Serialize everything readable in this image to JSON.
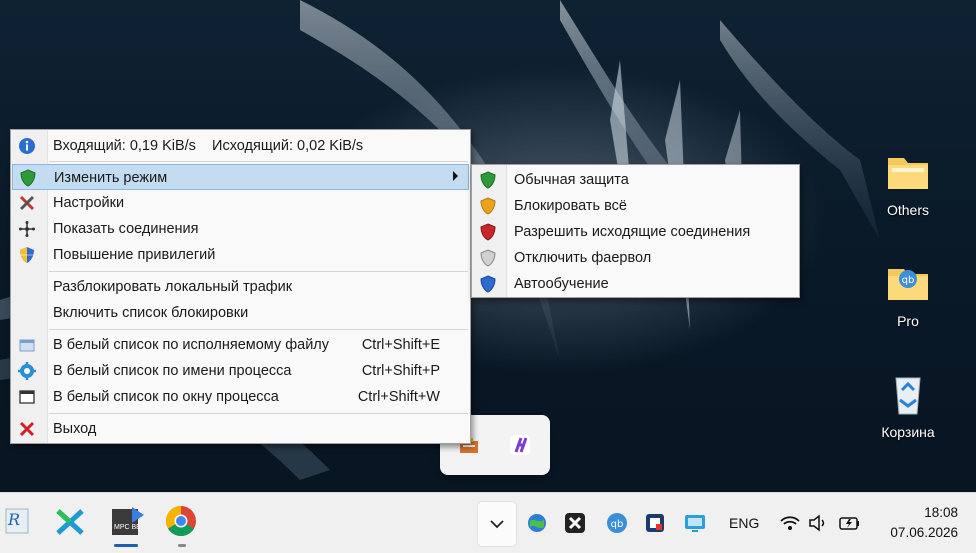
{
  "desktop": {
    "icons": [
      {
        "label": "Others",
        "icon": "folder-icon"
      },
      {
        "label": "Pro",
        "icon": "qbittorrent-folder-icon"
      },
      {
        "label": "Корзина",
        "icon": "recycle-bin-icon"
      }
    ]
  },
  "context_menu": {
    "traffic": {
      "label": "Входящий: 0,19 KiB/s    Исходящий: 0,02 KiB/s",
      "icon": "info-icon"
    },
    "items_group1": [
      {
        "label": "Изменить режим",
        "icon": "shield-green-icon",
        "highlighted": true,
        "has_submenu": true
      },
      {
        "label": "Настройки",
        "icon": "tools-icon"
      },
      {
        "label": "Показать соединения",
        "icon": "network-icon"
      },
      {
        "label": "Повышение привилегий",
        "icon": "uac-shield-icon"
      }
    ],
    "items_group2": [
      {
        "label": "Разблокировать локальный трафик"
      },
      {
        "label": "Включить список блокировки"
      }
    ],
    "items_group3": [
      {
        "label": "В белый список по исполняемому файлу",
        "shortcut": "Ctrl+Shift+E",
        "icon": "exe-file-icon"
      },
      {
        "label": "В белый список по имени процесса",
        "shortcut": "Ctrl+Shift+P",
        "icon": "process-gear-icon"
      },
      {
        "label": "В белый список по окну процесса",
        "shortcut": "Ctrl+Shift+W",
        "icon": "window-icon"
      }
    ],
    "exit": {
      "label": "Выход",
      "icon": "red-x-icon"
    }
  },
  "submenu": {
    "items": [
      {
        "label": "Обычная защита",
        "icon": "shield-green-icon",
        "color": "#2e9b3a"
      },
      {
        "label": "Блокировать всё",
        "icon": "shield-orange-icon",
        "color": "#e8a21c"
      },
      {
        "label": "Разрешить исходящие соединения",
        "icon": "shield-red-icon",
        "color": "#c9262b"
      },
      {
        "label": "Отключить фаервол",
        "icon": "shield-gray-icon",
        "color": "#a8a8a8"
      },
      {
        "label": "Автообучение",
        "icon": "shield-blue-icon",
        "color": "#2f6ad1"
      }
    ]
  },
  "taskbar": {
    "apps": [
      "reg-organizer-icon",
      "xnview-icon",
      "mpc-be-icon",
      "chrome-icon"
    ],
    "mpc_label": "MPC BE",
    "tray": [
      "overflow-chevron-icon",
      "globe-update-icon",
      "xnview-tray-icon",
      "qbittorrent-tray-icon",
      "screen-capture-icon",
      "remote-desktop-icon"
    ],
    "language": "ENG",
    "time": "18:08",
    "date": "07.06.2026"
  }
}
